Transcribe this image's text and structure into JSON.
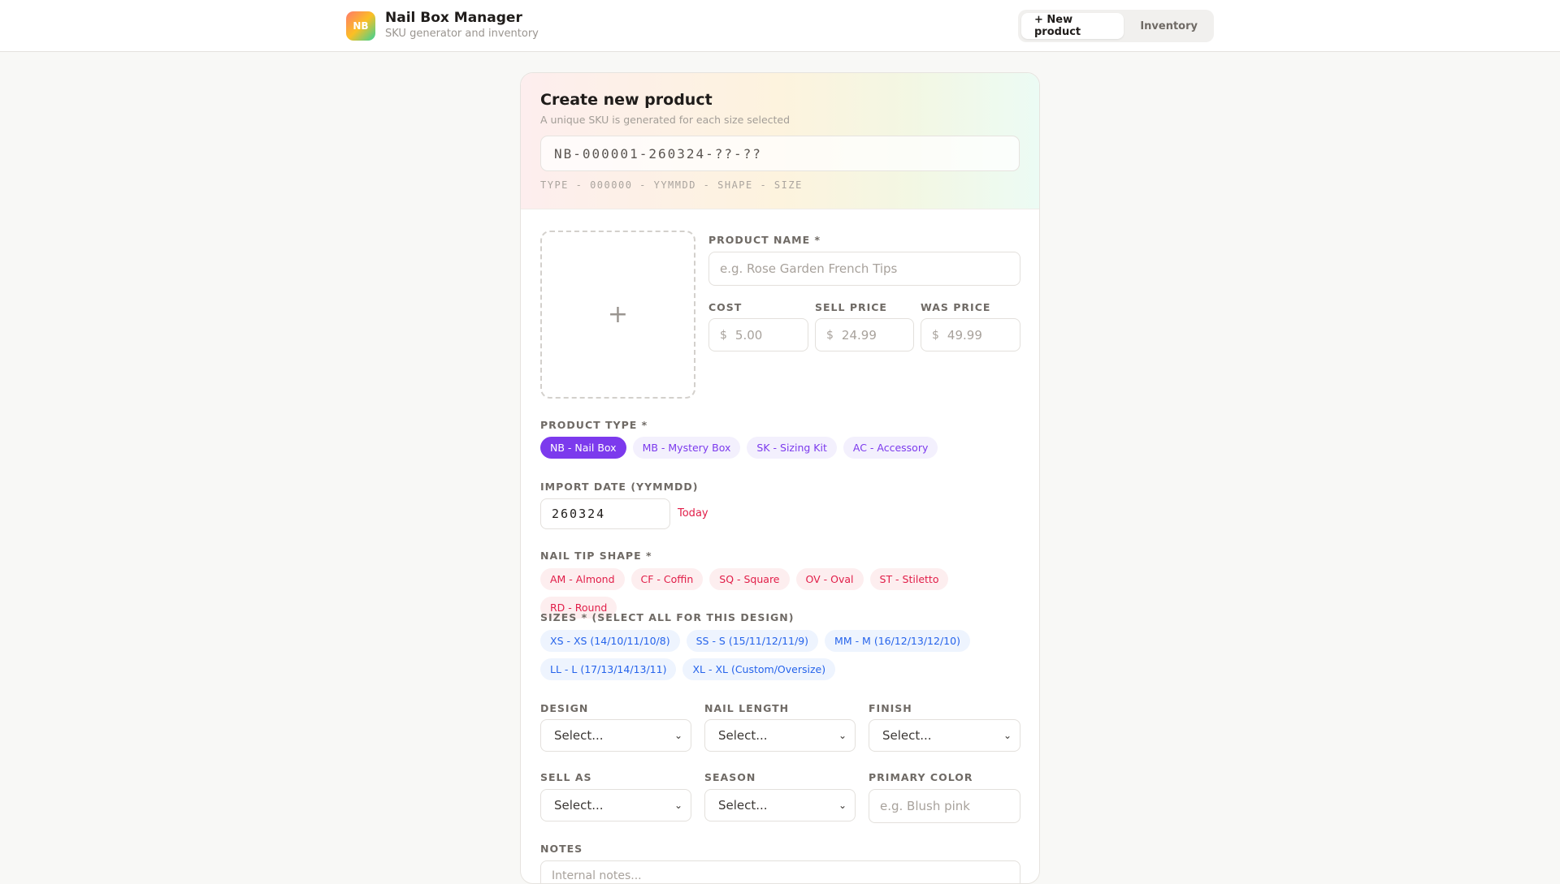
{
  "header": {
    "logo": "NB",
    "title": "Nail Box Manager",
    "subtitle": "SKU generator and inventory",
    "tabs": [
      {
        "label": "+ New product",
        "active": true
      },
      {
        "label": "Inventory",
        "active": false
      }
    ]
  },
  "form": {
    "title": "Create new product",
    "subtitle": "A unique SKU is generated for each size selected",
    "sku_preview": "NB-000001-260324-??-??",
    "sku_format": "TYPE - 000000 - YYMMDD - SHAPE - SIZE",
    "image_upload_icon": "plus-icon",
    "product_name": {
      "label": "PRODUCT NAME *",
      "placeholder": "e.g. Rose Garden French Tips"
    },
    "cost": {
      "label": "COST",
      "currency": "$",
      "placeholder": "5.00"
    },
    "sell_price": {
      "label": "SELL PRICE",
      "currency": "$",
      "placeholder": "24.99"
    },
    "was_price": {
      "label": "WAS PRICE",
      "currency": "$",
      "placeholder": "49.99"
    },
    "product_type": {
      "label": "PRODUCT TYPE *",
      "options": [
        "NB - Nail Box",
        "MB - Mystery Box",
        "SK - Sizing Kit",
        "AC - Accessory"
      ],
      "selected": "NB - Nail Box"
    },
    "import_date": {
      "label": "IMPORT DATE (YYMMDD)",
      "value": "260324",
      "today_link": "Today"
    },
    "nail_tip_shape": {
      "label": "NAIL TIP SHAPE *",
      "options": [
        "AM - Almond",
        "CF - Coffin",
        "SQ - Square",
        "OV - Oval",
        "ST - Stiletto",
        "RD - Round"
      ]
    },
    "sizes": {
      "label": "SIZES * (SELECT ALL FOR THIS DESIGN)",
      "options": [
        "XS - XS (14/10/11/10/8)",
        "SS - S (15/11/12/11/9)",
        "MM - M (16/12/13/12/10)",
        "LL - L (17/13/14/13/11)",
        "XL - XL (Custom/Oversize)"
      ]
    },
    "design": {
      "label": "DESIGN",
      "value": "Select..."
    },
    "nail_length": {
      "label": "NAIL LENGTH",
      "value": "Select..."
    },
    "finish": {
      "label": "FINISH",
      "value": "Select..."
    },
    "sell_as": {
      "label": "SELL AS",
      "value": "Select..."
    },
    "season": {
      "label": "SEASON",
      "value": "Select..."
    },
    "primary_color": {
      "label": "PRIMARY COLOR",
      "placeholder": "e.g. Blush pink"
    },
    "notes": {
      "label": "NOTES",
      "placeholder": "Internal notes..."
    }
  },
  "colors": {
    "accent": "#7c3aed",
    "shape": "#e11d48",
    "size": "#2563eb"
  }
}
